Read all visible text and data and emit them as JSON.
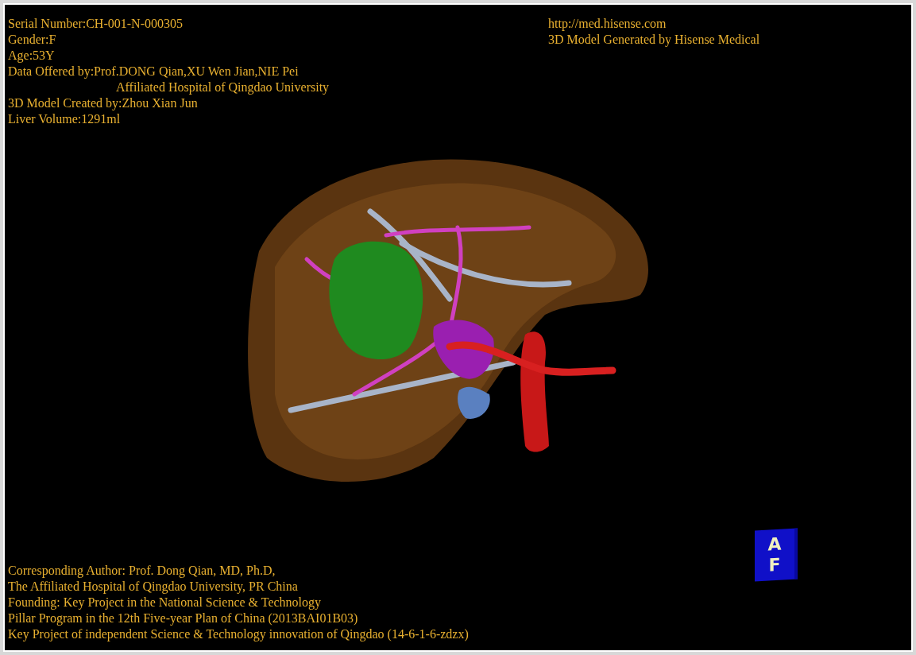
{
  "info_top_left": [
    {
      "text": "Serial Number:CH-001-N-000305",
      "kind": "line"
    },
    {
      "text": "Gender:F",
      "kind": "line"
    },
    {
      "text": "Age:53Y",
      "kind": "line"
    },
    {
      "text": "Data Offered by:Prof.DONG Qian,XU Wen Jian,NIE Pei",
      "kind": "line"
    },
    {
      "text": "Affiliated Hospital of Qingdao University",
      "kind": "continuation"
    },
    {
      "text": "3D Model Created by:Zhou Xian Jun",
      "kind": "line"
    },
    {
      "text": "Liver Volume:1291ml",
      "kind": "line"
    }
  ],
  "info_top_right": [
    "http://med.hisense.com",
    "3D Model Generated by Hisense Medical"
  ],
  "credits": [
    "Corresponding Author: Prof. Dong Qian, MD, Ph.D,",
    "The Affiliated Hospital of Qingdao University, PR China",
    "Founding: Key Project in the National Science & Technology",
    "Pillar Program in the 12th Five-year Plan of China (2013BAI01B03)",
    "Key Project of independent Science & Technology innovation of Qingdao (14-6-1-6-zdzx)"
  ],
  "orientation_cube": {
    "top_face": "A",
    "front_face": "F"
  }
}
